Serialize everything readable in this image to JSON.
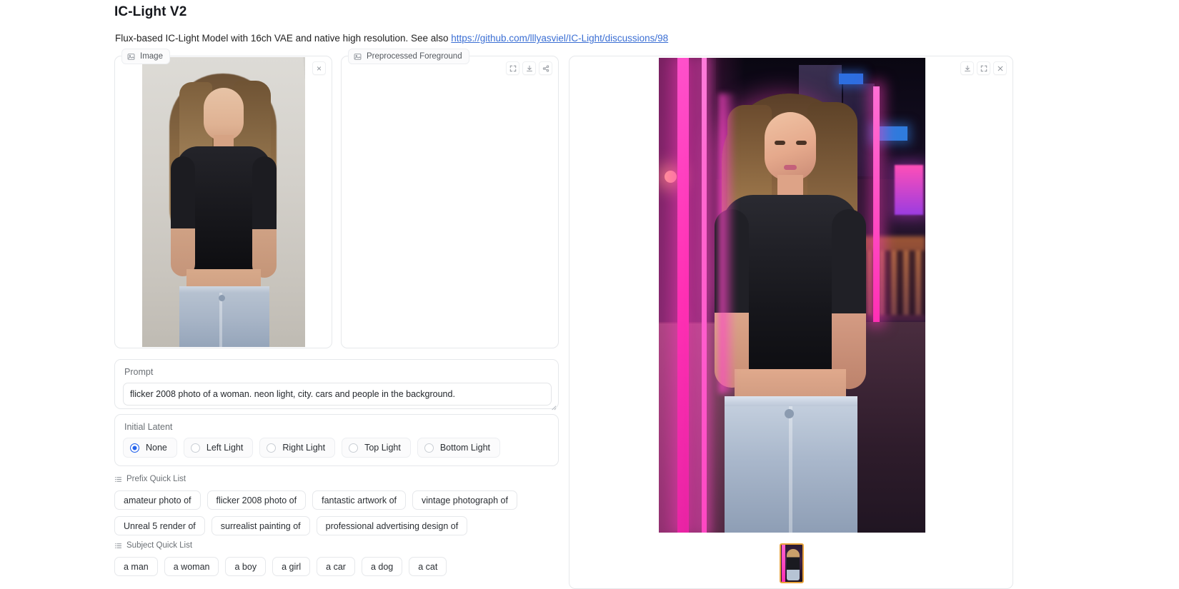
{
  "header": {
    "title": "IC-Light V2",
    "description_prefix": "Flux-based IC-Light Model with 16ch VAE and native high resolution. See also ",
    "link_text": "https://github.com/lllyasviel/IC-Light/discussions/98"
  },
  "panels": {
    "input_image": {
      "label": "Image",
      "icon": "image-icon",
      "close_label": "×"
    },
    "preprocessed_foreground": {
      "label": "Preprocessed Foreground",
      "icon": "image-icon",
      "tools": [
        "fullscreen-icon",
        "download-icon",
        "share-icon"
      ]
    },
    "output": {
      "tools": [
        "download-icon",
        "fullscreen-icon",
        "close-icon"
      ]
    }
  },
  "prompt": {
    "label": "Prompt",
    "value": "flicker 2008 photo of a woman. neon light, city. cars and people in the background.",
    "placeholder": ""
  },
  "initial_latent": {
    "label": "Initial Latent",
    "selected": "None",
    "options": [
      {
        "label": "None",
        "selected": true
      },
      {
        "label": "Left Light",
        "selected": false
      },
      {
        "label": "Right Light",
        "selected": false
      },
      {
        "label": "Top Light",
        "selected": false
      },
      {
        "label": "Bottom Light",
        "selected": false
      }
    ]
  },
  "prefix_quick_list": {
    "label": "Prefix Quick List",
    "icon": "list-icon",
    "items": [
      "amateur photo of",
      "flicker 2008 photo of",
      "fantastic artwork of",
      "vintage photograph of",
      "Unreal 5 render of",
      "surrealist painting of",
      "professional advertising design of"
    ]
  },
  "subject_quick_list": {
    "label": "Subject Quick List",
    "icon": "list-icon",
    "items": [
      "a man",
      "a woman",
      "a boy",
      "a girl",
      "a car",
      "a dog",
      "a cat"
    ]
  },
  "colors": {
    "accent": "#2563eb",
    "link": "#3b6fd4",
    "border": "#e6e8eb",
    "text": "#2b2f34",
    "muted": "#6b7075",
    "thumb_border": "#e8a33a"
  }
}
